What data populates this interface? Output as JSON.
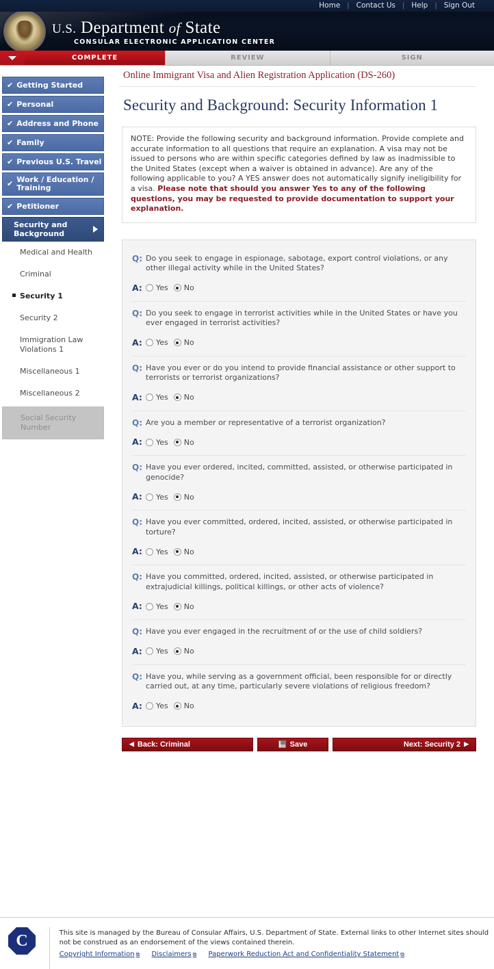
{
  "utility_nav": [
    {
      "label": "Home"
    },
    {
      "label": "Contact Us"
    },
    {
      "label": "Help"
    },
    {
      "label": "Sign Out"
    }
  ],
  "banner": {
    "title_prefix": "U.S.",
    "title_department": "Department",
    "title_of": "of",
    "title_state": "State",
    "subtitle": "CONSULAR ELECTRONIC APPLICATION CENTER",
    "seal_icon": "department-of-state-seal-icon"
  },
  "tabs": [
    {
      "label": "COMPLETE",
      "state": "active"
    },
    {
      "label": "REVIEW",
      "state": "inactive"
    },
    {
      "label": "SIGN",
      "state": "inactive"
    }
  ],
  "sidebar": {
    "completed": [
      {
        "label": "Getting Started",
        "check": "✔"
      },
      {
        "label": "Personal",
        "check": "✔"
      },
      {
        "label": "Address and Phone",
        "check": "✔"
      },
      {
        "label": "Family",
        "check": "✔"
      },
      {
        "label": "Previous U.S. Travel",
        "check": "✔"
      },
      {
        "label": "Work / Education / Training",
        "check": "✔"
      },
      {
        "label": "Petitioner",
        "check": "✔"
      }
    ],
    "active_section": {
      "label": "Security and Background"
    },
    "subitems": [
      {
        "label": "Medical and Health",
        "state": "normal"
      },
      {
        "label": "Criminal",
        "state": "normal"
      },
      {
        "label": "Security 1",
        "state": "current"
      },
      {
        "label": "Security 2",
        "state": "normal"
      },
      {
        "label": "Immigration Law Violations 1",
        "state": "normal"
      },
      {
        "label": "Miscellaneous 1",
        "state": "normal"
      },
      {
        "label": "Miscellaneous 2",
        "state": "normal"
      },
      {
        "label": "Social Security Number",
        "state": "disabled"
      }
    ]
  },
  "main": {
    "breadcrumb": "Online Immigrant Visa and Alien Registration Application (DS-260)",
    "page_title": "Security and Background: Security Information 1",
    "note": {
      "body": "NOTE: Provide the following security and background information. Provide complete and accurate information to all questions that require an explanation. A visa may not be issued to persons who are within specific categories defined by law as inadmissible to the United States (except when a waiver is obtained in advance). Are any of the following applicable to you? A YES answer does not automatically signify ineligibility for a visa. ",
      "emphasis": "Please note that should you answer Yes to any of the following questions, you may be requested to provide documentation to support your explanation."
    },
    "q_label": "Q:",
    "a_label": "A:",
    "option_yes": "Yes",
    "option_no": "No",
    "questions": [
      {
        "text": "Do you seek to engage in espionage, sabotage, export control violations, or any other illegal activity while in the United States?",
        "answer": "No"
      },
      {
        "text": "Do you seek to engage in terrorist activities while in the United States or have you ever engaged in terrorist activities?",
        "answer": "No"
      },
      {
        "text": "Have you ever or do you intend to provide financial assistance or other support to terrorists or terrorist organizations?",
        "answer": "No"
      },
      {
        "text": "Are you a member or representative of a terrorist organization?",
        "answer": "No"
      },
      {
        "text": "Have you ever ordered, incited, committed, assisted, or otherwise participated in genocide?",
        "answer": "No"
      },
      {
        "text": "Have you ever committed, ordered, incited, assisted, or otherwise participated in torture?",
        "answer": "No"
      },
      {
        "text": "Have you committed, ordered, incited, assisted, or otherwise participated in extrajudicial killings, political killings, or other acts of violence?",
        "answer": "No"
      },
      {
        "text": "Have you ever engaged in the recruitment of or the use of child soldiers?",
        "answer": "No"
      },
      {
        "text": "Have you, while serving as a government official, been responsible for or directly carried out, at any time, particularly severe violations of religious freedom?",
        "answer": "No"
      }
    ]
  },
  "actions": {
    "back_label": "Back: Criminal",
    "back_caret": "◀",
    "save_label": "Save",
    "save_icon": "floppy-disk-save-icon",
    "next_label": "Next: Security 2",
    "next_caret": "▶"
  },
  "footer": {
    "seal_icon": "consular-affairs-seal-icon",
    "text": "This site is managed by the Bureau of Consular Affairs, U.S. Department of State. External links to other Internet sites should not be construed as an endorsement of the views contained therein.",
    "links": [
      {
        "label": "Copyright Information",
        "external_icon": "⧉"
      },
      {
        "label": "Disclaimers",
        "external_icon": "⧉"
      },
      {
        "label": "Paperwork Reduction Act and Confidentiality Statement",
        "external_icon": "⧉"
      }
    ]
  }
}
